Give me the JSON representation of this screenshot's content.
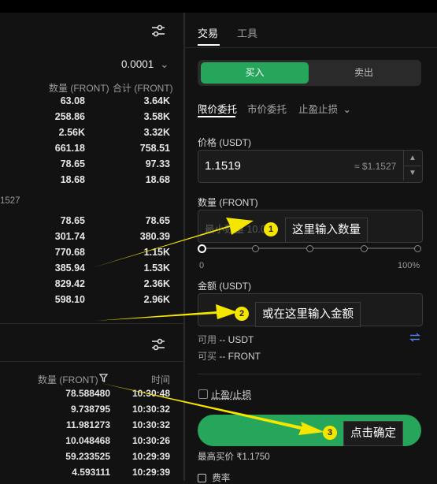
{
  "colors": {
    "buy_green": "#26a65a",
    "annotation_yellow": "#f5e600",
    "background": "#121212"
  },
  "orderbook": {
    "precision": "0.0001",
    "headers": {
      "qty": "数量 (FRONT)",
      "total": "合计 (FRONT)"
    },
    "asks": [
      {
        "qty": "63.08",
        "total": "3.64K"
      },
      {
        "qty": "258.86",
        "total": "3.58K"
      },
      {
        "qty": "2.56K",
        "total": "3.32K"
      },
      {
        "qty": "661.18",
        "total": "758.51"
      },
      {
        "qty": "78.65",
        "total": "97.33"
      },
      {
        "qty": "18.68",
        "total": "18.68"
      }
    ],
    "mid_price": "1527",
    "bids": [
      {
        "qty": "78.65",
        "total": "78.65"
      },
      {
        "qty": "301.74",
        "total": "380.39"
      },
      {
        "qty": "770.68",
        "total": "1.15K"
      },
      {
        "qty": "385.94",
        "total": "1.53K"
      },
      {
        "qty": "829.42",
        "total": "2.36K"
      },
      {
        "qty": "598.10",
        "total": "2.96K"
      }
    ]
  },
  "trades": {
    "headers": {
      "qty": "数量 (FRONT)",
      "time": "时间"
    },
    "rows": [
      {
        "qty": "78.588480",
        "time": "10:30:48"
      },
      {
        "qty": "9.738795",
        "time": "10:30:32"
      },
      {
        "qty": "11.981273",
        "time": "10:30:32"
      },
      {
        "qty": "10.048468",
        "time": "10:30:26"
      },
      {
        "qty": "59.233525",
        "time": "10:29:39"
      },
      {
        "qty": "4.593111",
        "time": "10:29:39"
      }
    ]
  },
  "panel": {
    "tabs": [
      "交易",
      "工具"
    ],
    "buy_label": "买入",
    "sell_label": "卖出",
    "order_types": [
      "限价委托",
      "市价委托",
      "止盈止损"
    ],
    "price_label": "价格 (USDT)",
    "price_value": "1.1519",
    "price_approx": "≈ $1.1527",
    "qty_label": "数量 (FRONT)",
    "qty_placeholder": "最小数量 10.000",
    "slider_min": "0",
    "slider_max": "100%",
    "slider_percent": 0,
    "amount_label": "金额 (USDT)",
    "available_label": "可用",
    "available_value": "-- USDT",
    "can_buy_label": "可买",
    "can_buy_value": "-- FRONT",
    "tpsl_label": "止盈/止损",
    "max_buy_label": "最高买价",
    "max_buy_value": "₹1.1750",
    "fee_label": "费率"
  },
  "annotations": [
    {
      "num": "1",
      "text": "这里输入数量"
    },
    {
      "num": "2",
      "text": "或在这里输入金额"
    },
    {
      "num": "3",
      "text": "点击确定"
    }
  ]
}
